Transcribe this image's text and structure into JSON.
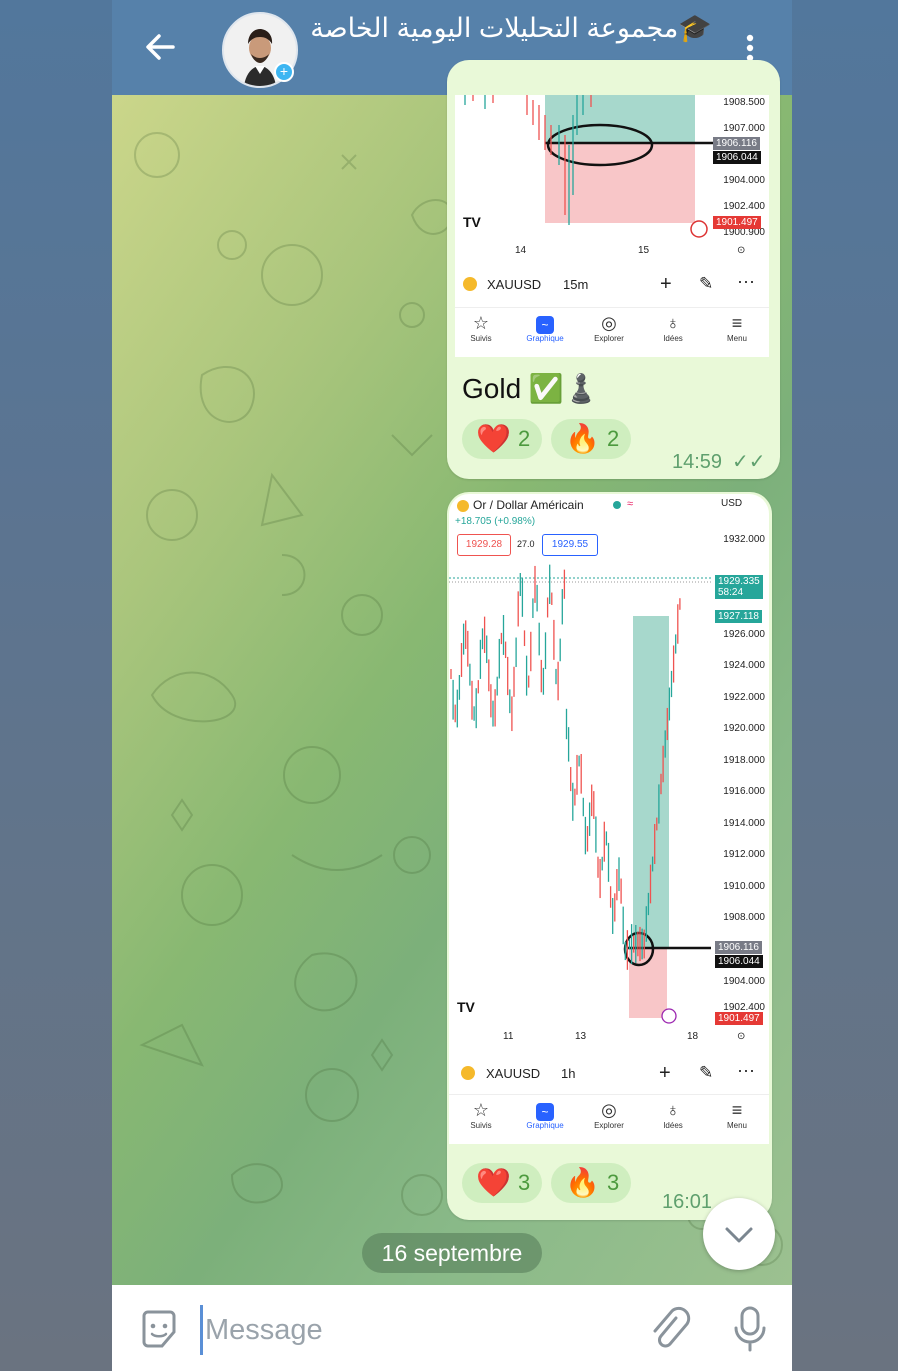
{
  "header": {
    "title": "🎓مجموعة التحليلات اليومية الخاصة",
    "back_icon": "arrow-left-icon",
    "menu_icon": "more-vertical-icon"
  },
  "messages": [
    {
      "chart": {
        "prices": [
          "1908.500",
          "1907.000",
          "1904.000",
          "1902.400",
          "1900.900"
        ],
        "tag_upper": "1906.116",
        "tag_lower": "1906.044",
        "tag_red": "1901.497",
        "x_labels": [
          "14",
          "15"
        ],
        "symbol": "XAUUSD",
        "interval": "15m"
      },
      "nav": [
        "Suivis",
        "Graphique",
        "Explorer",
        "Idées",
        "Menu"
      ],
      "caption": "Gold ✅♟️",
      "reactions": [
        {
          "emoji": "❤️",
          "count": "2"
        },
        {
          "emoji": "🔥",
          "count": "2"
        }
      ],
      "time": "14:59"
    },
    {
      "chart": {
        "symbol_name": "Or / Dollar Américain",
        "currency": "USD",
        "change": "+18.705 (+0.98%)",
        "bid": "1929.28",
        "spread": "27.0",
        "ask": "1929.55",
        "prices": [
          "1932.000",
          "1926.000",
          "1924.000",
          "1922.000",
          "1920.000",
          "1918.000",
          "1916.000",
          "1914.000",
          "1912.000",
          "1910.000",
          "1908.000",
          "1904.000",
          "1902.400"
        ],
        "tag_green_top": "1929.335",
        "tag_green_sub": "58:24",
        "tag_green2": "1927.118",
        "tag_upper": "1906.116",
        "tag_lower": "1906.044",
        "tag_red": "1901.497",
        "x_labels": [
          "11",
          "13",
          "18"
        ],
        "symbol": "XAUUSD",
        "interval": "1h"
      },
      "nav": [
        "Suivis",
        "Graphique",
        "Explorer",
        "Idées",
        "Menu"
      ],
      "reactions": [
        {
          "emoji": "❤️",
          "count": "3"
        },
        {
          "emoji": "🔥",
          "count": "3"
        }
      ],
      "time": "16:01"
    }
  ],
  "date_separator": "16 septembre",
  "input": {
    "placeholder": "Message"
  },
  "colors": {
    "header": "#5681aa",
    "bubble": "#e9f9d8",
    "reaction": "#cfeebf",
    "tv_green": "#26a69a",
    "tv_red": "#ef5350"
  }
}
